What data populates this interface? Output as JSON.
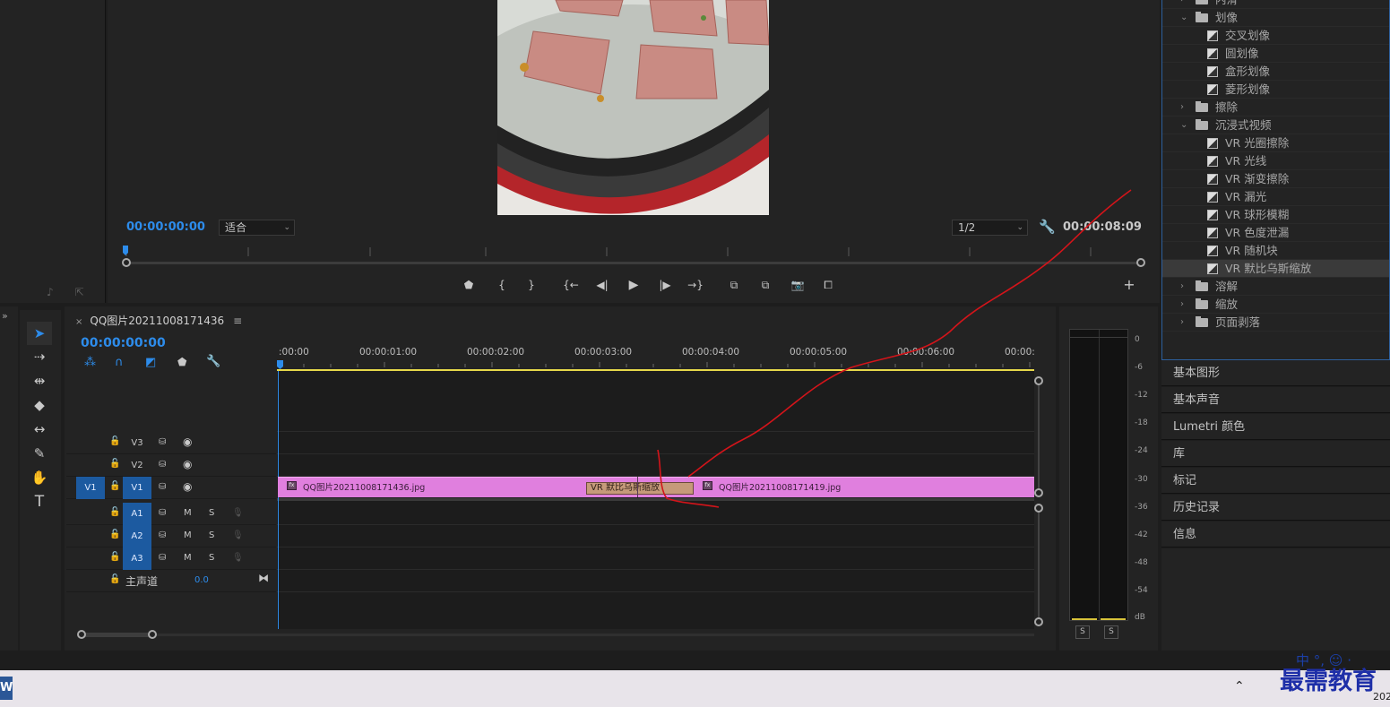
{
  "monitor": {
    "timecode_current": "00:00:00:00",
    "zoom_value": "适合",
    "resolution_value": "1/2",
    "timecode_duration": "00:00:08:09"
  },
  "effects_panel": {
    "items": [
      {
        "type": "folder",
        "expanded": false,
        "label": "内滑"
      },
      {
        "type": "folder",
        "expanded": true,
        "label": "划像"
      },
      {
        "type": "effect",
        "label": "交叉划像"
      },
      {
        "type": "effect",
        "label": "圆划像"
      },
      {
        "type": "effect",
        "label": "盒形划像"
      },
      {
        "type": "effect",
        "label": "菱形划像"
      },
      {
        "type": "folder",
        "expanded": false,
        "label": "擦除"
      },
      {
        "type": "folder",
        "expanded": true,
        "label": "沉浸式视频"
      },
      {
        "type": "effect",
        "label": "VR 光圈擦除"
      },
      {
        "type": "effect",
        "label": "VR 光线"
      },
      {
        "type": "effect",
        "label": "VR 渐变擦除"
      },
      {
        "type": "effect",
        "label": "VR 漏光"
      },
      {
        "type": "effect",
        "label": "VR 球形模糊"
      },
      {
        "type": "effect",
        "label": "VR 色度泄漏"
      },
      {
        "type": "effect",
        "label": "VR 随机块"
      },
      {
        "type": "effect",
        "label": "VR 默比乌斯缩放",
        "selected": true
      },
      {
        "type": "folder",
        "expanded": false,
        "label": "溶解"
      },
      {
        "type": "folder",
        "expanded": false,
        "label": "缩放"
      },
      {
        "type": "folder",
        "expanded": false,
        "label": "页面剥落"
      }
    ]
  },
  "side_panels": [
    "基本图形",
    "基本声音",
    "Lumetri 颜色",
    "库",
    "标记",
    "历史记录",
    "信息"
  ],
  "timeline": {
    "sequence_name": "QQ图片20211008171436",
    "timecode": "00:00:00:00",
    "ruler_labels": [
      ":00:00",
      "00:00:01:00",
      "00:00:02:00",
      "00:00:03:00",
      "00:00:04:00",
      "00:00:05:00",
      "00:00:06:00",
      "00:00:"
    ],
    "video_tracks": [
      {
        "name": "V3",
        "targeted": false
      },
      {
        "name": "V2",
        "targeted": false
      },
      {
        "name": "V1",
        "targeted": true,
        "source": "V1"
      }
    ],
    "audio_tracks": [
      {
        "name": "A1",
        "m": "M",
        "s": "S"
      },
      {
        "name": "A2",
        "m": "M",
        "s": "S"
      },
      {
        "name": "A3",
        "m": "M",
        "s": "S"
      }
    ],
    "master": {
      "label": "主声道",
      "value": "0.0"
    },
    "clips": {
      "clip_a": "QQ图片20211008171436.jpg",
      "clip_b": "QQ图片20211008171419.jpg",
      "transition": "VR 默比乌斯缩放",
      "fx_badge": "fx"
    }
  },
  "meter": {
    "db_labels": [
      "0",
      "-6",
      "-12",
      "-18",
      "-24",
      "-30",
      "-36",
      "-42",
      "-48",
      "-54",
      "dB"
    ],
    "solo_left": "S",
    "solo_right": "S"
  },
  "taskbar": {
    "word_icon": "W",
    "brand": "最需教育",
    "ime": "中 °, ☺ ·",
    "year": "202"
  },
  "colors": {
    "accent_blue": "#2d8ceb",
    "clip_pink": "#e07fde",
    "transition_tan": "#c69a7a",
    "annotation_red": "#d4141a",
    "work_area_yellow": "#e6d84a"
  }
}
